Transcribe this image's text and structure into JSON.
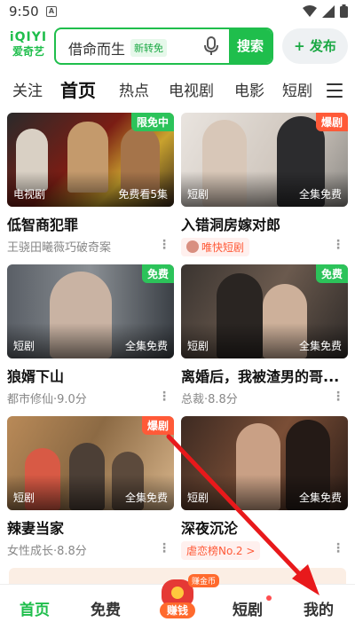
{
  "status": {
    "time": "9:50",
    "app_icon": "A"
  },
  "header": {
    "logo_top": "iQIYI",
    "logo_bottom": "爱奇艺",
    "search_placeholder": "借命而生",
    "search_tag": "新转免",
    "search_button": "搜索",
    "publish_button": "+ 发布"
  },
  "channels": [
    "关注",
    "首页",
    "热点",
    "电视剧",
    "电影",
    "短剧"
  ],
  "cards": [
    {
      "title": "低智商犯罪",
      "subtitle": "王骁田曦薇巧破奇案",
      "category": "电视剧",
      "free_text": "免费看5集",
      "badge": "限免中",
      "badge_color": "#2cc35a"
    },
    {
      "title": "入错洞房嫁对郎",
      "subtitle_pill": "唯快短剧",
      "category": "短剧",
      "free_text": "全集免费",
      "badge": "爆剧",
      "badge_color": "#ff5a38"
    },
    {
      "title": "狼婿下山",
      "subtitle": "都市修仙·9.0分",
      "category": "短剧",
      "free_text": "全集免费",
      "badge": "免费",
      "badge_color": "#2cc35a"
    },
    {
      "title": "离婚后，我被渣男的哥...",
      "subtitle": "总裁·8.8分",
      "category": "短剧",
      "free_text": "全集免费",
      "badge": "免费",
      "badge_color": "#2cc35a"
    },
    {
      "title": "辣妻当家",
      "subtitle": "女性成长·8.8分",
      "category": "短剧",
      "free_text": "全集免费",
      "badge": "爆剧",
      "badge_color": "#ff5a38"
    },
    {
      "title": "深夜沉沦",
      "subtitle_pill": "虐恋榜No.2 >",
      "category": "短剧",
      "free_text": "全集免费",
      "badge": "",
      "badge_color": ""
    }
  ],
  "more_icon": "⋮",
  "tabbar": {
    "home": "首页",
    "free": "免费",
    "earn": "赚钱",
    "earn_tip": "赚金币",
    "shorts": "短剧",
    "mine": "我的"
  }
}
